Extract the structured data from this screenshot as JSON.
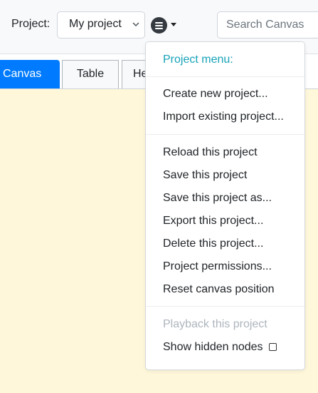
{
  "toolbar": {
    "project_label": "Project:",
    "project_select_value": "My project",
    "search_placeholder": "Search Canvas"
  },
  "tabs": [
    {
      "label": "Canvas",
      "active": true
    },
    {
      "label": "Table",
      "active": false
    },
    {
      "label": "He",
      "active": false
    }
  ],
  "dropdown": {
    "header": "Project menu:",
    "group1": [
      "Create new project...",
      "Import existing project..."
    ],
    "group2": [
      "Reload this project",
      "Save this project",
      "Save this project as...",
      "Export this project...",
      "Delete this project...",
      "Project permissions...",
      "Reset canvas position"
    ],
    "group3": {
      "playback": "Playback this project",
      "show_hidden": "Show hidden nodes",
      "show_hidden_checked": false
    }
  },
  "colors": {
    "primary": "#007bff",
    "header_teal": "#17a2b8",
    "canvas_bg": "#fef7da",
    "toolbar_bg": "#f8f9fa",
    "menu_icon": "#343a40"
  }
}
